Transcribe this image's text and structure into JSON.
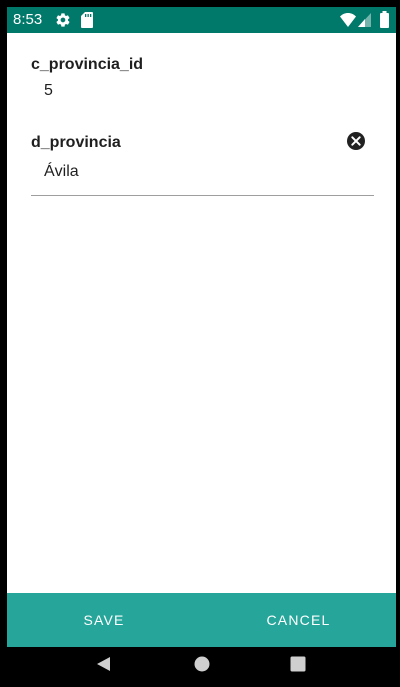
{
  "status_bar": {
    "time": "8:53",
    "icons": [
      "gear-icon",
      "sd-card-icon",
      "wifi-icon",
      "signal-icon",
      "battery-icon"
    ],
    "background_color": "#00796b"
  },
  "form": {
    "fields": [
      {
        "label": "c_provincia_id",
        "value": "5"
      },
      {
        "label": "d_provincia",
        "value": "Ávila",
        "clear_icon": "clear-circle-icon"
      }
    ]
  },
  "actions": {
    "save_label": "SAVE",
    "cancel_label": "CANCEL",
    "background_color": "#26a69a"
  },
  "navigation": {
    "icons": [
      "back-icon",
      "home-icon",
      "recents-icon"
    ]
  }
}
